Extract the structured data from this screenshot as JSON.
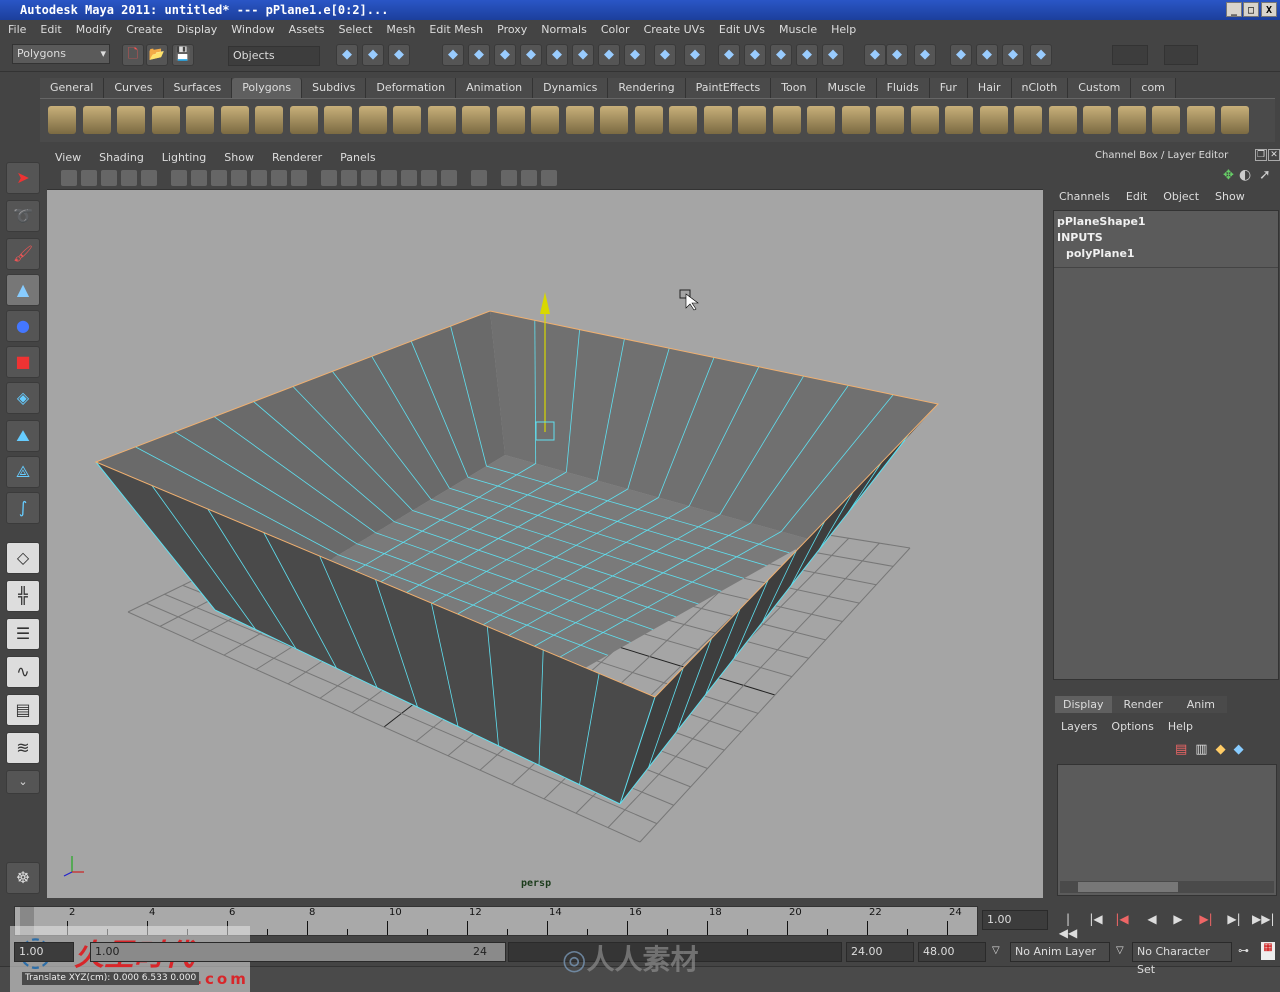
{
  "window": {
    "title": "Autodesk Maya 2011: untitled*    ---    pPlane1.e[0:2]...",
    "minimize": "_",
    "maximize": "□",
    "close": "X"
  },
  "menubar": [
    "File",
    "Edit",
    "Modify",
    "Create",
    "Display",
    "Window",
    "Assets",
    "Select",
    "Mesh",
    "Edit Mesh",
    "Proxy",
    "Normals",
    "Color",
    "Create UVs",
    "Edit UVs",
    "Muscle",
    "Help"
  ],
  "statusline": {
    "menuset": "Polygons",
    "selection_mask": "Objects"
  },
  "shelf": {
    "tabs": [
      "General",
      "Curves",
      "Surfaces",
      "Polygons",
      "Subdivs",
      "Deformation",
      "Animation",
      "Dynamics",
      "Rendering",
      "PaintEffects",
      "Toon",
      "Muscle",
      "Fluids",
      "Fur",
      "Hair",
      "nCloth",
      "Custom",
      "com"
    ],
    "active": "Polygons"
  },
  "panel": {
    "menus": [
      "View",
      "Shading",
      "Lighting",
      "Show",
      "Renderer",
      "Panels"
    ],
    "camera": "persp"
  },
  "channelbox": {
    "title": "Channel Box / Layer Editor",
    "menus": [
      "Channels",
      "Edit",
      "Object",
      "Show"
    ],
    "shape": "pPlaneShape1",
    "inputs_label": "INPUTS",
    "input_node": "polyPlane1"
  },
  "layereditor": {
    "tabs": [
      "Display",
      "Render",
      "Anim"
    ],
    "active": "Display",
    "menus": [
      "Layers",
      "Options",
      "Help"
    ]
  },
  "timeline": {
    "ticks": [
      "1",
      "2",
      "4",
      "6",
      "8",
      "10",
      "12",
      "14",
      "16",
      "18",
      "20",
      "22",
      "24"
    ],
    "current_time": "1.00",
    "range_start": "1.00",
    "range_inner_start": "1.00",
    "range_inner_end": "24",
    "playback_end": "24.00",
    "anim_end": "48.00",
    "anim_layer": "No Anim Layer",
    "character_set": "No Character Set"
  },
  "helpline": "Translate XYZ(cm): 0.000 6.533 0.000",
  "watermarks": [
    "火星时代",
    "www.hxsd.com",
    "人人素材"
  ],
  "colors": {
    "viewport_bg": "#a5a5a5",
    "wire": "#5fe0f0",
    "mesh": "#4c4c4c",
    "selected_edge": "#f0b070",
    "manip_y": "#d8d800"
  }
}
